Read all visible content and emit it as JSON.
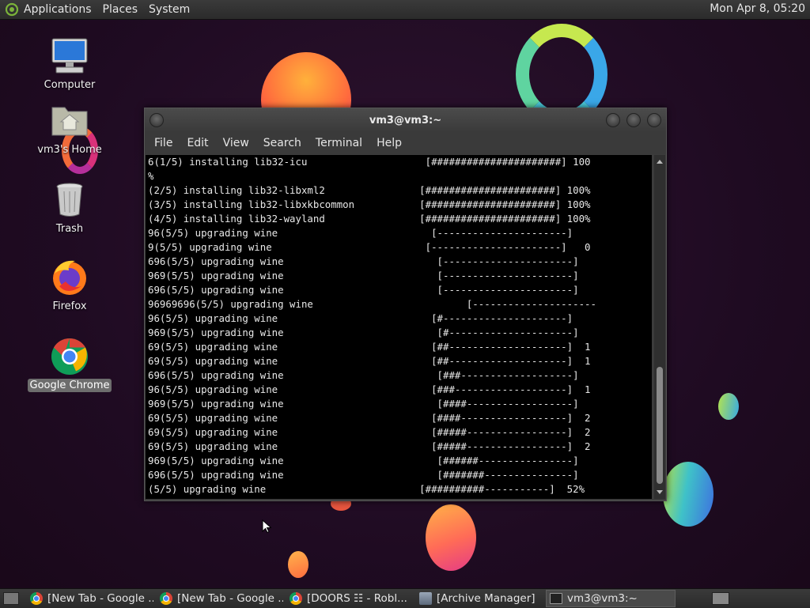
{
  "top_panel": {
    "menus": [
      "Applications",
      "Places",
      "System"
    ],
    "clock": "Mon Apr 8, 05:20"
  },
  "desktop_icons": [
    {
      "label": "Computer",
      "icon": "computer-icon"
    },
    {
      "label": "vm3's Home",
      "icon": "home-folder-icon"
    },
    {
      "label": "Trash",
      "icon": "trash-icon"
    },
    {
      "label": "Firefox",
      "icon": "firefox-icon"
    },
    {
      "label": "Google Chrome",
      "icon": "chrome-icon",
      "selected": true
    }
  ],
  "terminal": {
    "title": "vm3@vm3:~",
    "menu": [
      "File",
      "Edit",
      "View",
      "Search",
      "Terminal",
      "Help"
    ],
    "lines": [
      "6(1/5) installing lib32-icu                    [######################] 100",
      "%",
      "(2/5) installing lib32-libxml2                [######################] 100%",
      "(3/5) installing lib32-libxkbcommon           [######################] 100%",
      "(4/5) installing lib32-wayland                [######################] 100%",
      "96(5/5) upgrading wine                          [----------------------]",
      "9(5/5) upgrading wine                          [----------------------]   0",
      "696(5/5) upgrading wine                          [----------------------]",
      "969(5/5) upgrading wine                          [----------------------]",
      "696(5/5) upgrading wine                          [----------------------]",
      "96969696(5/5) upgrading wine                          [---------------------",
      "96(5/5) upgrading wine                          [#---------------------]",
      "969(5/5) upgrading wine                          [#---------------------]",
      "69(5/5) upgrading wine                          [##--------------------]  1",
      "69(5/5) upgrading wine                          [##--------------------]  1",
      "696(5/5) upgrading wine                          [###-------------------]",
      "96(5/5) upgrading wine                          [###-------------------]  1",
      "969(5/5) upgrading wine                          [####------------------]",
      "69(5/5) upgrading wine                          [####------------------]  2",
      "69(5/5) upgrading wine                          [#####-----------------]  2",
      "69(5/5) upgrading wine                          [#####-----------------]  2",
      "969(5/5) upgrading wine                          [######----------------]",
      "696(5/5) upgrading wine                          [#######---------------]",
      "(5/5) upgrading wine                          [##########-----------]  52%"
    ]
  },
  "taskbar": {
    "tasks": [
      {
        "label": "[New Tab - Google ...",
        "icon": "chrome-icon"
      },
      {
        "label": "[New Tab - Google ...",
        "icon": "chrome-icon"
      },
      {
        "label": "[DOORS ☷ - Robl...",
        "icon": "chrome-icon"
      },
      {
        "label": "[Archive Manager]",
        "icon": "archive-manager-icon"
      },
      {
        "label": "vm3@vm3:~",
        "icon": "terminal-icon",
        "active": true
      }
    ]
  }
}
